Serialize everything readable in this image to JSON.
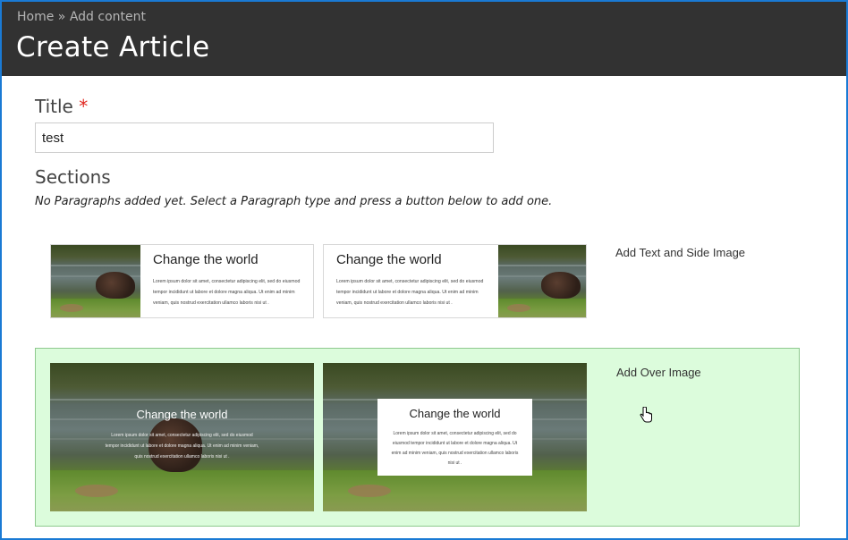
{
  "breadcrumb": {
    "home": "Home",
    "separator": "»",
    "current": "Add content"
  },
  "page": {
    "title": "Create Article"
  },
  "title_field": {
    "label": "Title",
    "required_mark": "*",
    "value": "test"
  },
  "sections": {
    "label": "Sections",
    "empty_message": "No Paragraphs added yet. Select a Paragraph type and press a button below to add one."
  },
  "paragraph_types": [
    {
      "button_label": "Add Text and Side Image",
      "preview_heading": "Change the world",
      "preview_text": "Lorem ipsum dolor sit amet, consectetur adipiscing elit, sed do eiusmod tempor incididunt ut labore et dolore magna aliqua. Ut enim ad minim veniam, quis nostrud exercitation ullamco laboris nisi ut ."
    },
    {
      "button_label": "Add Over Image",
      "preview_heading": "Change the world",
      "preview_text_a": "Lorem ipsum dolor sit amet, consectetur adipiscing elit, sed do eiusmod tempor incididunt ut labore et dolore magna aliqua. Ut enim ad minim veniam, quis nostrud exercitation ullamco laboris nisi ut .",
      "preview_text_b": "Lorem ipsum dolor sit amet, consectetur adipiscing elit, sed do eiusmod tempor incididunt ut labore et dolore magna aliqua. Ut enim ad minim veniam, quis nostrud exercitation ullamco laboris nisi ut ."
    }
  ],
  "colors": {
    "header_bg": "#323232",
    "selected_bg": "#dcfcdc",
    "required": "#e0261e",
    "frame": "#1a7ad4"
  },
  "icons": {
    "cursor": "hand-pointer-icon"
  }
}
